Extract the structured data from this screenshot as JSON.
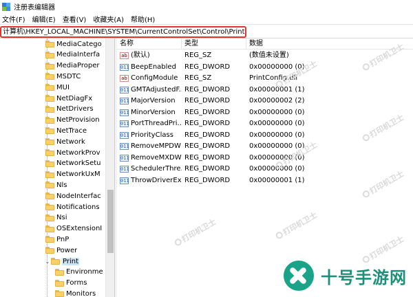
{
  "window": {
    "title": "注册表编辑器"
  },
  "menu": [
    {
      "label": "文件(F)"
    },
    {
      "label": "编辑(E)"
    },
    {
      "label": "查看(V)"
    },
    {
      "label": "收藏夹(A)"
    },
    {
      "label": "帮助(H)"
    }
  ],
  "address": {
    "value": "计算机\\HKEY_LOCAL_MACHINE\\SYSTEM\\CurrentControlSet\\Control\\Print"
  },
  "tree": {
    "items": [
      {
        "label": "MediaCatego",
        "selected": false,
        "expander": ""
      },
      {
        "label": "MediaInterfa",
        "selected": false,
        "expander": ""
      },
      {
        "label": "MediaProper",
        "selected": false,
        "expander": ""
      },
      {
        "label": "MSDTC",
        "selected": false,
        "expander": ""
      },
      {
        "label": "MUI",
        "selected": false,
        "expander": ""
      },
      {
        "label": "NetDiagFx",
        "selected": false,
        "expander": ""
      },
      {
        "label": "NetDrivers",
        "selected": false,
        "expander": ""
      },
      {
        "label": "NetProvision",
        "selected": false,
        "expander": ""
      },
      {
        "label": "NetTrace",
        "selected": false,
        "expander": ""
      },
      {
        "label": "Network",
        "selected": false,
        "expander": ""
      },
      {
        "label": "NetworkProv",
        "selected": false,
        "expander": ""
      },
      {
        "label": "NetworkSetu",
        "selected": false,
        "expander": ""
      },
      {
        "label": "NetworkUxM",
        "selected": false,
        "expander": ""
      },
      {
        "label": "Nls",
        "selected": false,
        "expander": ""
      },
      {
        "label": "NodeInterfac",
        "selected": false,
        "expander": ""
      },
      {
        "label": "Notifications",
        "selected": false,
        "expander": ""
      },
      {
        "label": "Nsi",
        "selected": false,
        "expander": ""
      },
      {
        "label": "OSExtensionI",
        "selected": false,
        "expander": ""
      },
      {
        "label": "PnP",
        "selected": false,
        "expander": ""
      },
      {
        "label": "Power",
        "selected": false,
        "expander": ""
      },
      {
        "label": "Print",
        "selected": true,
        "expander": "⌄"
      },
      {
        "label": "Environme",
        "selected": false,
        "expander": "",
        "child": true
      },
      {
        "label": "Forms",
        "selected": false,
        "expander": "",
        "child": true
      },
      {
        "label": "Monitors",
        "selected": false,
        "expander": "",
        "child": true
      }
    ]
  },
  "columns": {
    "name": "名称",
    "type": "类型",
    "data": "数据"
  },
  "values": [
    {
      "icon": "sz",
      "icon_text": "ab",
      "name": "(默认)",
      "type": "REG_SZ",
      "data": "(数值未设置)"
    },
    {
      "icon": "dw",
      "icon_text": "011",
      "name": "BeepEnabled",
      "type": "REG_DWORD",
      "data": "0x00000000 (0)"
    },
    {
      "icon": "sz",
      "icon_text": "ab",
      "name": "ConfigModule",
      "type": "REG_SZ",
      "data": "PrintConfig.dll"
    },
    {
      "icon": "dw",
      "icon_text": "011",
      "name": "GMTAdjustedF...",
      "type": "REG_DWORD",
      "data": "0x00000001 (1)"
    },
    {
      "icon": "dw",
      "icon_text": "011",
      "name": "MajorVersion",
      "type": "REG_DWORD",
      "data": "0x00000002 (2)"
    },
    {
      "icon": "dw",
      "icon_text": "011",
      "name": "MinorVersion",
      "type": "REG_DWORD",
      "data": "0x00000000 (0)"
    },
    {
      "icon": "dw",
      "icon_text": "011",
      "name": "PortThreadPri...",
      "type": "REG_DWORD",
      "data": "0x00000000 (0)"
    },
    {
      "icon": "dw",
      "icon_text": "011",
      "name": "PriorityClass",
      "type": "REG_DWORD",
      "data": "0x00000000 (0)"
    },
    {
      "icon": "dw",
      "icon_text": "011",
      "name": "RemoveMPDW",
      "type": "REG_DWORD",
      "data": "0x00000000 (0)"
    },
    {
      "icon": "dw",
      "icon_text": "011",
      "name": "RemoveMXDW",
      "type": "REG_DWORD",
      "data": "0x00000000 (0)"
    },
    {
      "icon": "dw",
      "icon_text": "011",
      "name": "SchedulerThre...",
      "type": "REG_DWORD",
      "data": "0x00000000 (0)"
    },
    {
      "icon": "dw",
      "icon_text": "011",
      "name": "ThrowDriverEx...",
      "type": "REG_DWORD",
      "data": "0x00000001 (1)"
    }
  ],
  "watermark": {
    "text": "打印机卫士"
  },
  "brand": {
    "text": "十号手游网",
    "color": "#1aa388"
  }
}
